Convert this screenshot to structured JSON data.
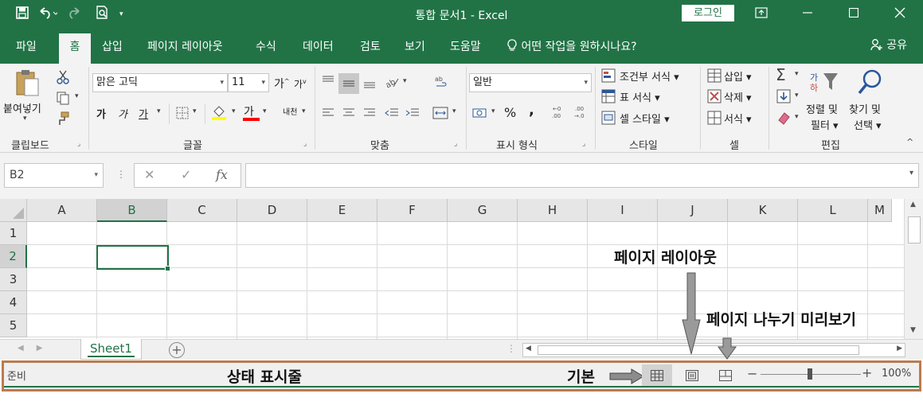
{
  "titlebar": {
    "title": "통합 문서1  -  Excel",
    "login_label": "로그인",
    "qat_icons": [
      "save-icon",
      "undo-icon",
      "redo-icon",
      "print-preview-icon",
      "customize-icon"
    ]
  },
  "menu": {
    "tabs": [
      "파일",
      "홈",
      "삽입",
      "페이지 레이아웃",
      "수식",
      "데이터",
      "검토",
      "보기",
      "도움말",
      "어떤 작업을 원하시나요?"
    ],
    "active": "홈",
    "share_label": "공유"
  },
  "ribbon": {
    "clipboard": {
      "paste_label": "붙여넣기",
      "group_label": "클립보드"
    },
    "font": {
      "font_name": "맑은 고딕",
      "font_size": "11",
      "grow_label": "가",
      "shrink_label": "가",
      "bold_label": "가",
      "italic_label": "가",
      "underline_label": "가",
      "font_color_label": "가",
      "phonetic_label": "내천",
      "group_label": "글꼴",
      "highlight_color": "#ffff00",
      "font_color": "#ff0000"
    },
    "alignment": {
      "group_label": "맞춤"
    },
    "number": {
      "format": "일반",
      "percent_label": "%",
      "comma_label": ",",
      "group_label": "표시 형식"
    },
    "styles": {
      "conditional_label": "조건부 서식",
      "table_label": "표 서식",
      "cell_style_label": "셀 스타일",
      "group_label": "스타일"
    },
    "cells": {
      "insert_label": "삽입",
      "delete_label": "삭제",
      "format_label": "서식",
      "group_label": "셀"
    },
    "editing": {
      "sort_label_1": "정렬 및",
      "sort_label_2": "필터",
      "find_label_1": "찾기 및",
      "find_label_2": "선택",
      "group_label": "편집"
    }
  },
  "formula_bar": {
    "name_box": "B2",
    "cancel": "✕",
    "enter": "✓",
    "fx": "fx",
    "value": ""
  },
  "grid": {
    "columns": [
      "A",
      "B",
      "C",
      "D",
      "E",
      "F",
      "G",
      "H",
      "I",
      "J",
      "K",
      "L",
      "M"
    ],
    "rows": [
      "1",
      "2",
      "3",
      "4",
      "5"
    ],
    "active_cell": "B2"
  },
  "sheets": {
    "tabs": [
      "Sheet1"
    ],
    "active": "Sheet1"
  },
  "status": {
    "ready": "준비",
    "zoom": "100%",
    "zoom_level": 1.0
  },
  "annotations": {
    "page_layout": "페이지 레이아웃",
    "page_break": "페이지 나누기 미리보기",
    "status_bar": "상태 표시줄",
    "normal": "기본",
    "arrow_color": "#8c8c8c",
    "frame_color": "#b87c52"
  },
  "colors": {
    "accent": "#217346",
    "ribbon_bg": "#f3f3f3"
  }
}
